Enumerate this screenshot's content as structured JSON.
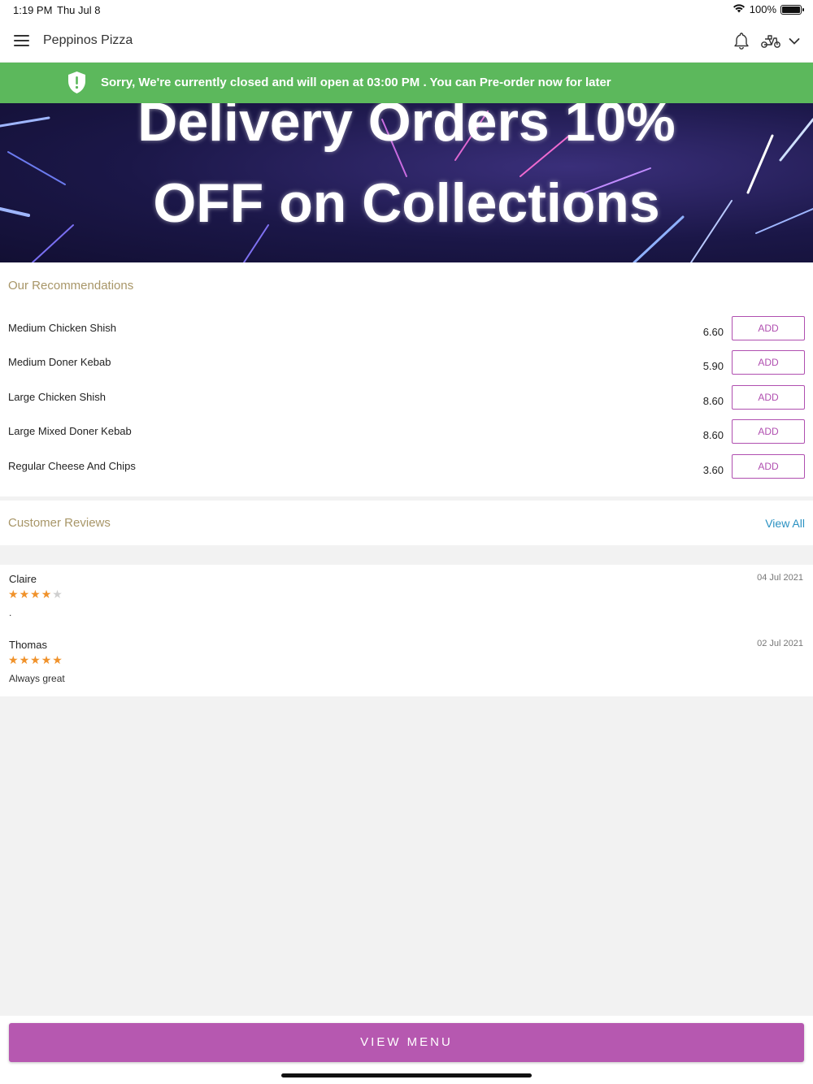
{
  "status_bar": {
    "time": "1:19 PM",
    "date": "Thu Jul 8",
    "battery": "100%"
  },
  "app_bar": {
    "title": "Peppinos Pizza"
  },
  "closed_banner": {
    "message": "Sorry, We're currently closed and will open at 03:00 PM . You can Pre-order now for later"
  },
  "promo": {
    "line1": "Delivery Orders 10%",
    "line2": "OFF on Collections"
  },
  "recommendations": {
    "title": "Our Recommendations",
    "add_label": "ADD",
    "items": [
      {
        "name": "Medium Chicken Shish",
        "price": "6.60"
      },
      {
        "name": "Medium Doner Kebab",
        "price": "5.90"
      },
      {
        "name": "Large Chicken Shish",
        "price": "8.60"
      },
      {
        "name": "Large Mixed Doner Kebab",
        "price": "8.60"
      },
      {
        "name": "Regular Cheese And Chips",
        "price": "3.60"
      }
    ]
  },
  "reviews": {
    "title": "Customer Reviews",
    "view_all": "View All",
    "items": [
      {
        "name": "Claire",
        "date": "04 Jul 2021",
        "rating": 4,
        "text": "."
      },
      {
        "name": "Thomas",
        "date": "02 Jul 2021",
        "rating": 5,
        "text": "Always great"
      }
    ]
  },
  "footer": {
    "view_menu": "VIEW MENU"
  },
  "colors": {
    "banner_green": "#5cb85c",
    "accent_purple": "#b658b0",
    "section_title": "#a89668",
    "link_blue": "#2a91c2",
    "star_on": "#f0922b",
    "star_off": "#cfcfcf"
  },
  "icons": [
    "menu-icon",
    "bell-icon",
    "scooter-icon",
    "chevron-down-icon",
    "shield-alert-icon",
    "wifi-icon",
    "battery-icon",
    "star-icon"
  ]
}
